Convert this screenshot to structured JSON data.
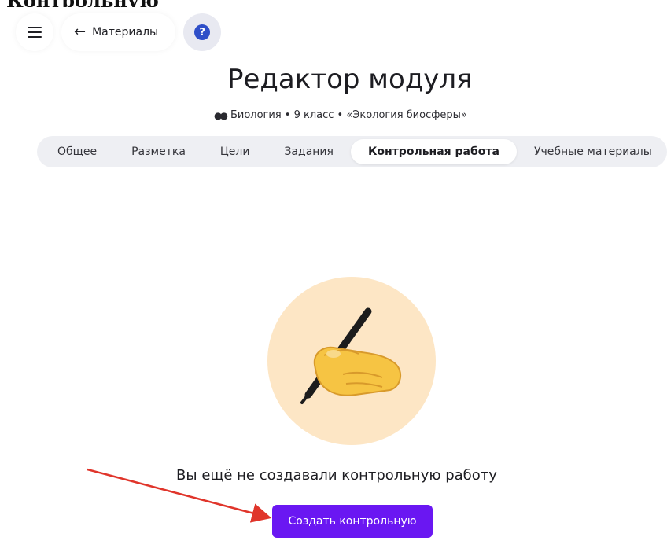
{
  "doc_fragment": "Контрольную",
  "topbar": {
    "back_label": "Материалы",
    "help_glyph": "?"
  },
  "header": {
    "title": "Редактор модуля",
    "subtitle": "Биология • 9 класс • «Экология биосферы»"
  },
  "tabs": [
    {
      "label": "Общее",
      "active": false
    },
    {
      "label": "Разметка",
      "active": false
    },
    {
      "label": "Цели",
      "active": false
    },
    {
      "label": "Задания",
      "active": false
    },
    {
      "label": "Контрольная работа",
      "active": true
    },
    {
      "label": "Учебные материалы",
      "active": false
    }
  ],
  "empty_state": {
    "illustration": "writing-hand-icon",
    "message": "Вы ещё не создавали контрольную работу",
    "button_label": "Создать контрольную"
  },
  "colors": {
    "accent": "#6a17f2",
    "help": "#2f4fc8",
    "annotation_arrow": "#e0352b",
    "circle": "#fde6c5"
  }
}
